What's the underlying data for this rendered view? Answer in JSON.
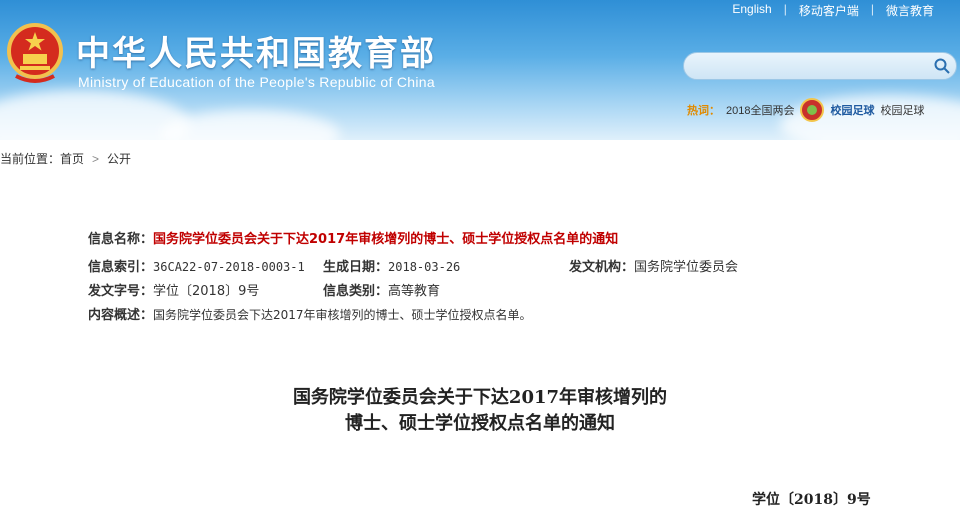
{
  "header": {
    "title_cn": "中华人民共和国教育部",
    "title_en": "Ministry of Education of the People's Republic of China",
    "links": [
      "English",
      "移动客户端",
      "微言教育"
    ],
    "search_placeholder": "",
    "hot_label": "热词：",
    "hot_items": [
      "2018全国两会",
      "校园足球",
      "校园足球"
    ]
  },
  "breadcrumb": {
    "prefix": "当前位置：",
    "items": [
      "首页",
      "公开"
    ]
  },
  "info": {
    "name_label": "信息名称：",
    "name_value": "国务院学位委员会关于下达2017年审核增列的博士、硕士学位授权点名单的通知",
    "index_label": "信息索引：",
    "index_value": "36CA22-07-2018-0003-1",
    "date_label": "生成日期：",
    "date_value": "2018-03-26",
    "org_label": "发文机构：",
    "org_value": "国务院学位委员会",
    "docno_label": "发文字号：",
    "docno_value": "学位〔2018〕9号",
    "category_label": "信息类别：",
    "category_value": "高等教育",
    "summary_label": "内容概述：",
    "summary_value": "国务院学位委员会下达2017年审核增列的博士、硕士学位授权点名单。"
  },
  "document": {
    "title_line1": "国务院学位委员会关于下达2017年审核增列的",
    "title_line2": "博士、硕士学位授权点名单的通知",
    "number": "学位〔2018〕9号"
  },
  "colors": {
    "header_blue": "#2f8fd6",
    "title_red": "#c00000"
  }
}
